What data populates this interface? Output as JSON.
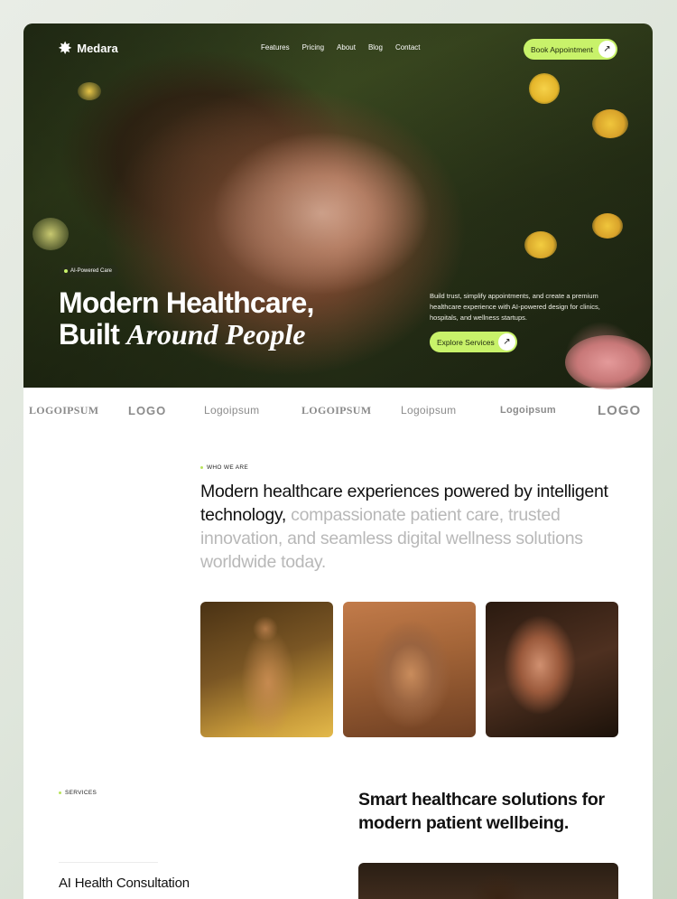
{
  "brand": {
    "name": "Medara",
    "logo_icon": "sunburst-icon"
  },
  "nav": {
    "links": [
      "Features",
      "Pricing",
      "About",
      "Blog",
      "Contact"
    ],
    "cta_label": "Book Appointment",
    "cta_icon": "arrow-up-right-icon"
  },
  "hero": {
    "badge": "AI-Powered Care",
    "title_line1": "Modern Healthcare,",
    "title_line2_plain": "Built",
    "title_line2_italic": "Around People",
    "description": "Build trust, simplify appointments, and create a premium healthcare experience with AI-powered design for clinics, hospitals, and wellness startups.",
    "cta_label": "Explore Services",
    "cta_icon": "arrow-up-right-icon"
  },
  "logos": [
    "LOGOIPSUM",
    "LOGO",
    "Logoipsum",
    "LOGOIPSUM",
    "Logoipsum",
    "Logoipsum",
    "LOGO"
  ],
  "who": {
    "eyebrow": "WHO WE ARE",
    "text_dark": "Modern healthcare experiences powered by intelligent technology,",
    "text_muted": "compassionate patient care, trusted innovation, and seamless digital wellness solutions worldwide today."
  },
  "services": {
    "eyebrow": "SERVICES",
    "title": "Smart healthcare solutions for modern patient wellbeing.",
    "first_item": "AI Health Consultation"
  },
  "colors": {
    "accent": "#c8f26a",
    "muted_text": "#b8b8b8"
  }
}
